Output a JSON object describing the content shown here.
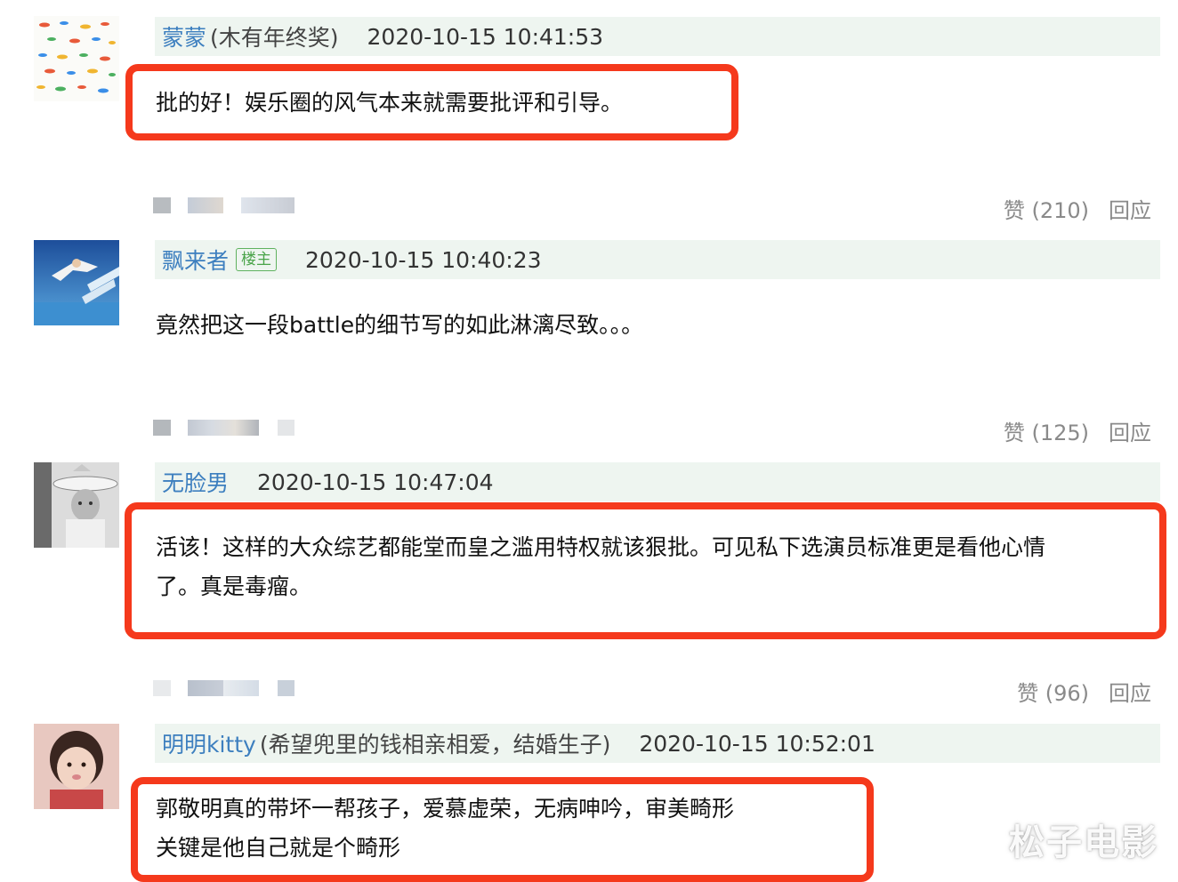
{
  "comments": [
    {
      "username": "蒙蒙",
      "signature": "(木有年终奖)",
      "timestamp": "2020-10-15 10:41:53",
      "content": "批的好！娱乐圈的风气本来就需要批评和引导。",
      "likes": "赞 (210)",
      "reply": "回应",
      "avatar_icon": "colorful-fish-pattern-avatar"
    },
    {
      "username": "飘来者",
      "owner_badge": "楼主",
      "timestamp": "2020-10-15 10:40:23",
      "content": "竟然把这一段battle的细节写的如此淋漓尽致。。。",
      "likes": "赞 (125)",
      "reply": "回应",
      "avatar_icon": "blue-sky-swimmer-avatar"
    },
    {
      "username": "无脸男",
      "timestamp": "2020-10-15 10:47:04",
      "content": "活该！这样的大众综艺都能堂而皇之滥用特权就该狠批。可见私下选演员标准更是看他心情\n了。真是毒瘤。",
      "likes": "赞 (96)",
      "reply": "回应",
      "avatar_icon": "black-white-child-hat-avatar"
    },
    {
      "username": "明明kitty",
      "signature": "(希望兜里的钱相亲相爱，结婚生子)",
      "timestamp": "2020-10-15 10:52:01",
      "content": "郭敬明真的带坏一帮孩子，爱慕虚荣，无病呻吟，审美畸形\n关键是他自己就是个畸形",
      "avatar_icon": "little-girl-avatar"
    }
  ],
  "watermark": "松子电影",
  "colors": {
    "username": "#3d7fbf",
    "header_bg": "#eef5f0",
    "highlight_border": "#f5391c",
    "owner_badge": "#4aa44a",
    "action_text": "#8a8a8a"
  }
}
